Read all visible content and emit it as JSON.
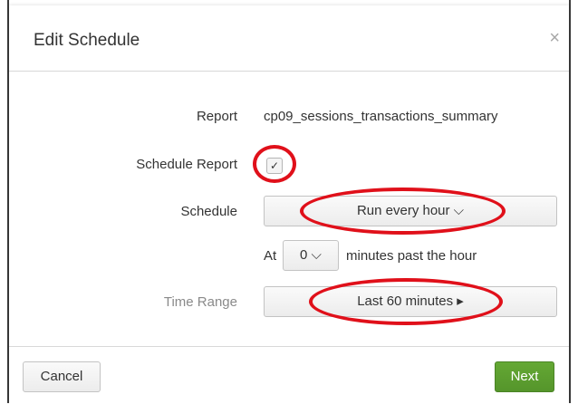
{
  "dialog": {
    "title": "Edit Schedule",
    "close_symbol": "×"
  },
  "form": {
    "report_label": "Report",
    "report_value": "cp09_sessions_transactions_summary",
    "schedule_report_label": "Schedule Report",
    "schedule_report_checked": true,
    "checkbox_glyph": "✓",
    "schedule_label": "Schedule",
    "schedule_value": "Run every hour ⌵",
    "at_label": "At",
    "minutes_value": "0 ⌵",
    "minutes_suffix": "minutes past the hour",
    "time_range_label": "Time Range",
    "time_range_value": "Last 60 minutes ▸"
  },
  "footer": {
    "cancel_label": "Cancel",
    "next_label": "Next"
  },
  "colors": {
    "annotation_red": "#e0101a",
    "next_green": "#5c9e30"
  }
}
